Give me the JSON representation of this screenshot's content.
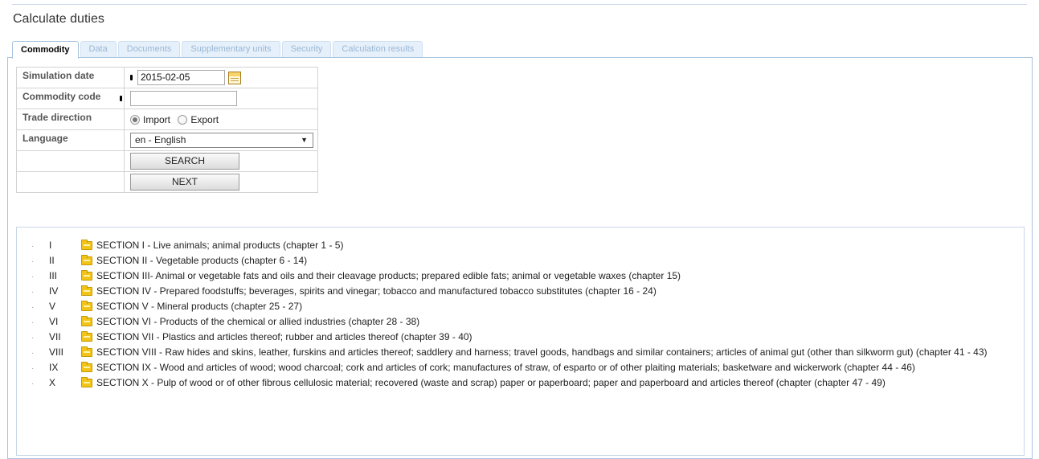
{
  "page": {
    "title": "Calculate duties"
  },
  "tabs": [
    {
      "label": "Commodity",
      "active": true
    },
    {
      "label": "Data",
      "active": false
    },
    {
      "label": "Documents",
      "active": false
    },
    {
      "label": "Supplementary units",
      "active": false
    },
    {
      "label": "Security",
      "active": false
    },
    {
      "label": "Calculation results",
      "active": false
    }
  ],
  "form": {
    "simulation_date": {
      "label": "Simulation date",
      "value": "2015-02-05"
    },
    "commodity_code": {
      "label": "Commodity code",
      "value": ""
    },
    "trade_direction": {
      "label": "Trade direction",
      "options": [
        "Import",
        "Export"
      ],
      "selected": "Import"
    },
    "language": {
      "label": "Language",
      "selected": "en - English"
    },
    "search_label": "SEARCH",
    "next_label": "NEXT"
  },
  "sections": [
    {
      "num": "I",
      "text": "SECTION I - Live animals; animal products (chapter 1 - 5)"
    },
    {
      "num": "II",
      "text": "SECTION II - Vegetable products (chapter 6 - 14)"
    },
    {
      "num": "III",
      "text": "SECTION III- Animal or vegetable fats and oils and their cleavage products; prepared edible fats; animal or vegetable waxes (chapter 15)"
    },
    {
      "num": "IV",
      "text": "SECTION IV - Prepared foodstuffs; beverages, spirits and vinegar; tobacco and manufactured tobacco substitutes (chapter 16 - 24)"
    },
    {
      "num": "V",
      "text": "SECTION V - Mineral products (chapter 25 - 27)"
    },
    {
      "num": "VI",
      "text": "SECTION VI - Products of the chemical or allied industries (chapter 28 - 38)"
    },
    {
      "num": "VII",
      "text": "SECTION VII - Plastics and articles thereof; rubber and articles thereof (chapter 39 - 40)"
    },
    {
      "num": "VIII",
      "text": "SECTION VIII - Raw hides and skins, leather, furskins and articles thereof; saddlery and harness; travel goods, handbags and similar containers; articles of animal gut (other than silkworm gut) (chapter 41 - 43)"
    },
    {
      "num": "IX",
      "text": "SECTION IX - Wood and articles of wood; wood charcoal; cork and articles of cork; manufactures of straw, of esparto or of other plaiting materials; basketware and wickerwork (chapter 44 - 46)"
    },
    {
      "num": "X",
      "text": "SECTION X - Pulp of wood or of other fibrous cellulosic material; recovered (waste and scrap) paper or paperboard; paper and paperboard and articles thereof (chapter (chapter 47 - 49)"
    }
  ]
}
